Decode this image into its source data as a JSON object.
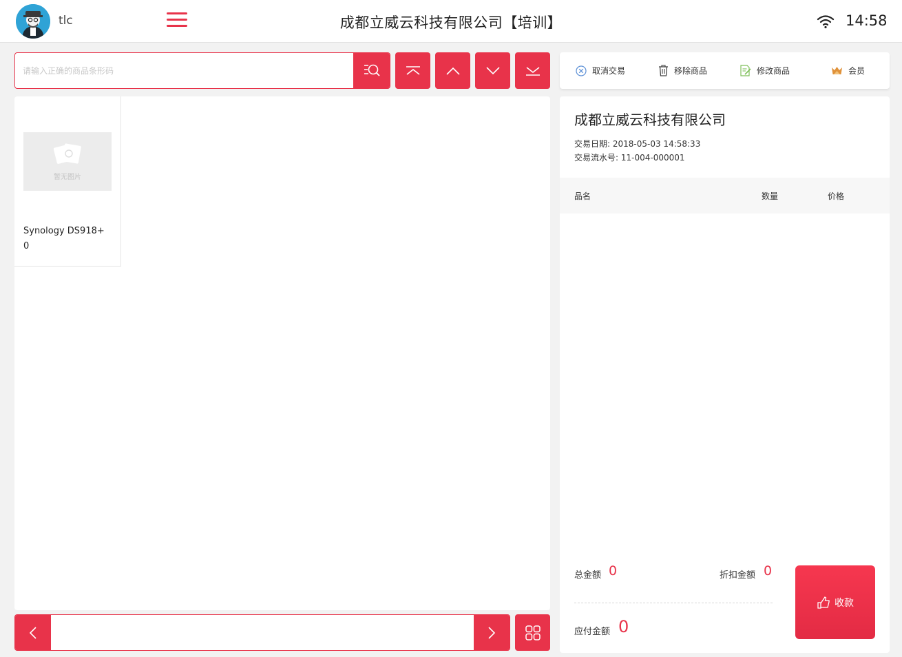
{
  "header": {
    "username": "tlc",
    "title": "成都立威云科技有限公司【培训】",
    "time": "14:58",
    "avatar_icon": "avatar-icon",
    "menu_icon": "hamburger-menu-icon",
    "wifi_icon": "wifi-icon"
  },
  "search": {
    "placeholder": "请输入正确的商品条形码",
    "value": ""
  },
  "toolbar": {
    "cancel_label": "取消交易",
    "remove_label": "移除商品",
    "edit_label": "修改商品",
    "member_label": "会员"
  },
  "products": [
    {
      "name": "Synology DS918+",
      "price": "0",
      "image_text": "暂无图片"
    }
  ],
  "receipt": {
    "company": "成都立威云科技有限公司",
    "date_label": "交易日期:",
    "date_value": "2018-05-03 14:58:33",
    "serial_label": "交易流水号:",
    "serial_value": "11-004-000001",
    "columns": [
      "品名",
      "数量",
      "价格"
    ],
    "items": []
  },
  "summary": {
    "total_label": "总金额",
    "total_value": "0",
    "discount_label": "折扣金额",
    "discount_value": "0",
    "payable_label": "应付金额",
    "payable_value": "0",
    "pay_label": "收款"
  },
  "colors": {
    "accent": "#e8334a",
    "background": "#f2f2f2",
    "panel": "#ffffff"
  }
}
